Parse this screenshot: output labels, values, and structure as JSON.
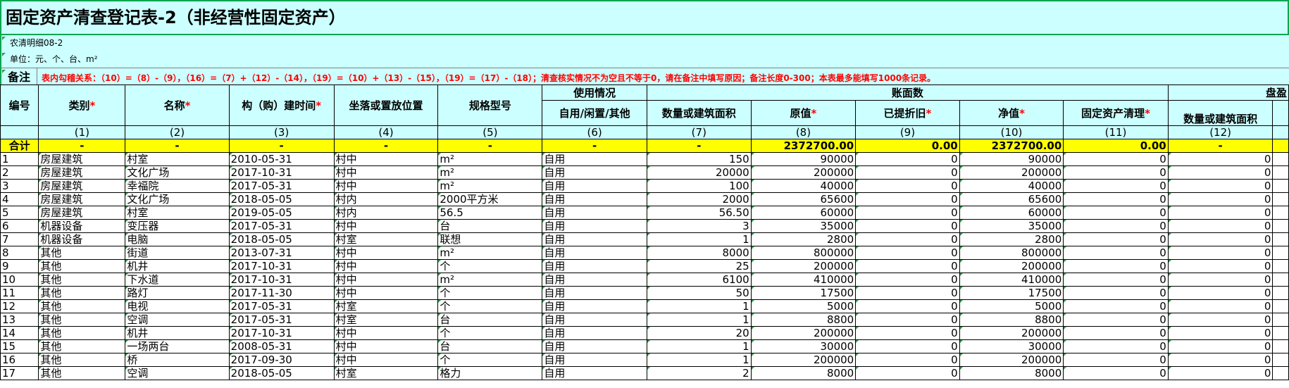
{
  "title": "固定资产清查登记表-2（非经营性固定资产）",
  "form_code": "农清明细08-2",
  "unit": "单位：元、个、台、m²",
  "note_label": "备注",
  "note_text": "表内勾稽关系：（10）=（8）-（9），（16）=（7）+（12）-（14），（19）=（10）+（13）-（15），（19）=（17）-（18）；清查核实情况不为空且不等于0，请在备注中填写原因；备注长度0-300；本表最多能填写1000条记录。",
  "headers": {
    "no": "编号",
    "category": "类别",
    "name": "名称",
    "build_time": "构（购）建时间",
    "location": "坐落或置放位置",
    "spec": "规格型号",
    "usage_group": "使用情况",
    "usage": "自用/闲置/其他",
    "book_group": "账面数",
    "qty": "数量或建筑面积",
    "orig": "原值",
    "depr": "已提折旧",
    "net": "净值",
    "clear": "固定资产清理",
    "surplus_group": "盘盈",
    "surplus_qty": "数量或建筑面积",
    "required_mark": "*"
  },
  "index_row": [
    "",
    "(1)",
    "(2)",
    "(3)",
    "(4)",
    "(5)",
    "(6)",
    "(7)",
    "(8)",
    "(9)",
    "(10)",
    "(11)",
    "(12)",
    ""
  ],
  "total_row": [
    "合计",
    "-",
    "-",
    "-",
    "-",
    "-",
    "-",
    "-",
    "2372700.00",
    "0.00",
    "2372700.00",
    "0.00",
    "-",
    ""
  ],
  "rows": [
    [
      "1",
      "房屋建筑",
      "村室",
      "2010-05-31",
      "村中",
      "m²",
      "自用",
      "150",
      "90000",
      "0",
      "90000",
      "0",
      "0"
    ],
    [
      "2",
      "房屋建筑",
      "文化广场",
      "2017-10-31",
      "村中",
      "m²",
      "自用",
      "20000",
      "200000",
      "0",
      "200000",
      "0",
      "0"
    ],
    [
      "3",
      "房屋建筑",
      "幸福院",
      "2017-05-31",
      "村中",
      "m²",
      "自用",
      "100",
      "40000",
      "0",
      "40000",
      "0",
      "0"
    ],
    [
      "4",
      "房屋建筑",
      "文化广场",
      "2018-05-05",
      "村内",
      "2000平方米",
      "自用",
      "2000",
      "65600",
      "0",
      "65600",
      "0",
      "0"
    ],
    [
      "5",
      "房屋建筑",
      "村室",
      "2019-05-05",
      "村内",
      "56.5",
      "自用",
      "56.50",
      "60000",
      "0",
      "60000",
      "0",
      "0"
    ],
    [
      "6",
      "机器设备",
      "变压器",
      "2017-05-31",
      "村中",
      "台",
      "自用",
      "3",
      "35000",
      "0",
      "35000",
      "0",
      "0"
    ],
    [
      "7",
      "机器设备",
      "电脑",
      "2018-05-05",
      "村室",
      "联想",
      "自用",
      "1",
      "2800",
      "0",
      "2800",
      "0",
      "0"
    ],
    [
      "8",
      "其他",
      "街道",
      "2013-07-31",
      "村中",
      "m²",
      "自用",
      "8000",
      "800000",
      "0",
      "800000",
      "0",
      "0"
    ],
    [
      "9",
      "其他",
      "机井",
      "2017-10-31",
      "村中",
      "个",
      "自用",
      "25",
      "200000",
      "0",
      "200000",
      "0",
      "0"
    ],
    [
      "10",
      "其他",
      "下水道",
      "2017-10-31",
      "村中",
      "m²",
      "自用",
      "6100",
      "410000",
      "0",
      "410000",
      "0",
      "0"
    ],
    [
      "11",
      "其他",
      "路灯",
      "2017-11-30",
      "村中",
      "个",
      "自用",
      "50",
      "17500",
      "0",
      "17500",
      "0",
      "0"
    ],
    [
      "12",
      "其他",
      "电视",
      "2017-05-31",
      "村室",
      "个",
      "自用",
      "1",
      "5000",
      "0",
      "5000",
      "0",
      "0"
    ],
    [
      "13",
      "其他",
      "空调",
      "2017-05-31",
      "村室",
      "台",
      "自用",
      "1",
      "8800",
      "0",
      "8800",
      "0",
      "0"
    ],
    [
      "14",
      "其他",
      "机井",
      "2017-10-31",
      "村中",
      "个",
      "自用",
      "20",
      "200000",
      "0",
      "200000",
      "0",
      "0"
    ],
    [
      "15",
      "其他",
      "一场两台",
      "2008-05-31",
      "村中",
      "台",
      "自用",
      "1",
      "30000",
      "0",
      "30000",
      "0",
      "0"
    ],
    [
      "16",
      "其他",
      "桥",
      "2017-09-30",
      "村中",
      "个",
      "自用",
      "1",
      "200000",
      "0",
      "200000",
      "0",
      "0"
    ],
    [
      "17",
      "其他",
      "空调",
      "2018-05-05",
      "村室",
      "格力",
      "自用",
      "2",
      "8000",
      "0",
      "8000",
      "0",
      "0"
    ]
  ],
  "colors": {
    "header_bg": "#ccffff",
    "total_bg": "#ffff00",
    "border_green": "#00a651",
    "required": "#ff0000"
  }
}
